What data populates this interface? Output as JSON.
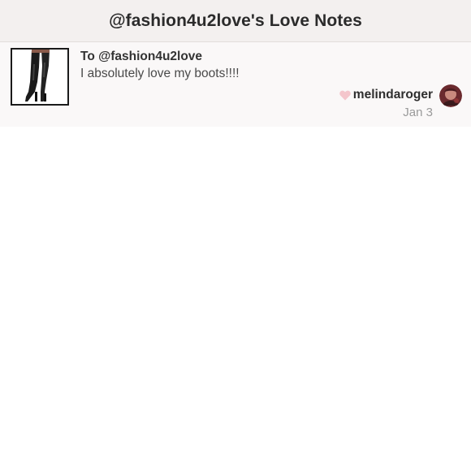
{
  "header": {
    "title": "@fashion4u2love's Love Notes"
  },
  "note": {
    "product_icon": "thigh-high-boots-image",
    "to_line": "To @fashion4u2love",
    "message": "I absolutely love my boots!!!!",
    "sender": "melindaroger",
    "date": "Jan 3",
    "heart_icon": "heart-icon",
    "heart_color": "#f4c6cc"
  }
}
